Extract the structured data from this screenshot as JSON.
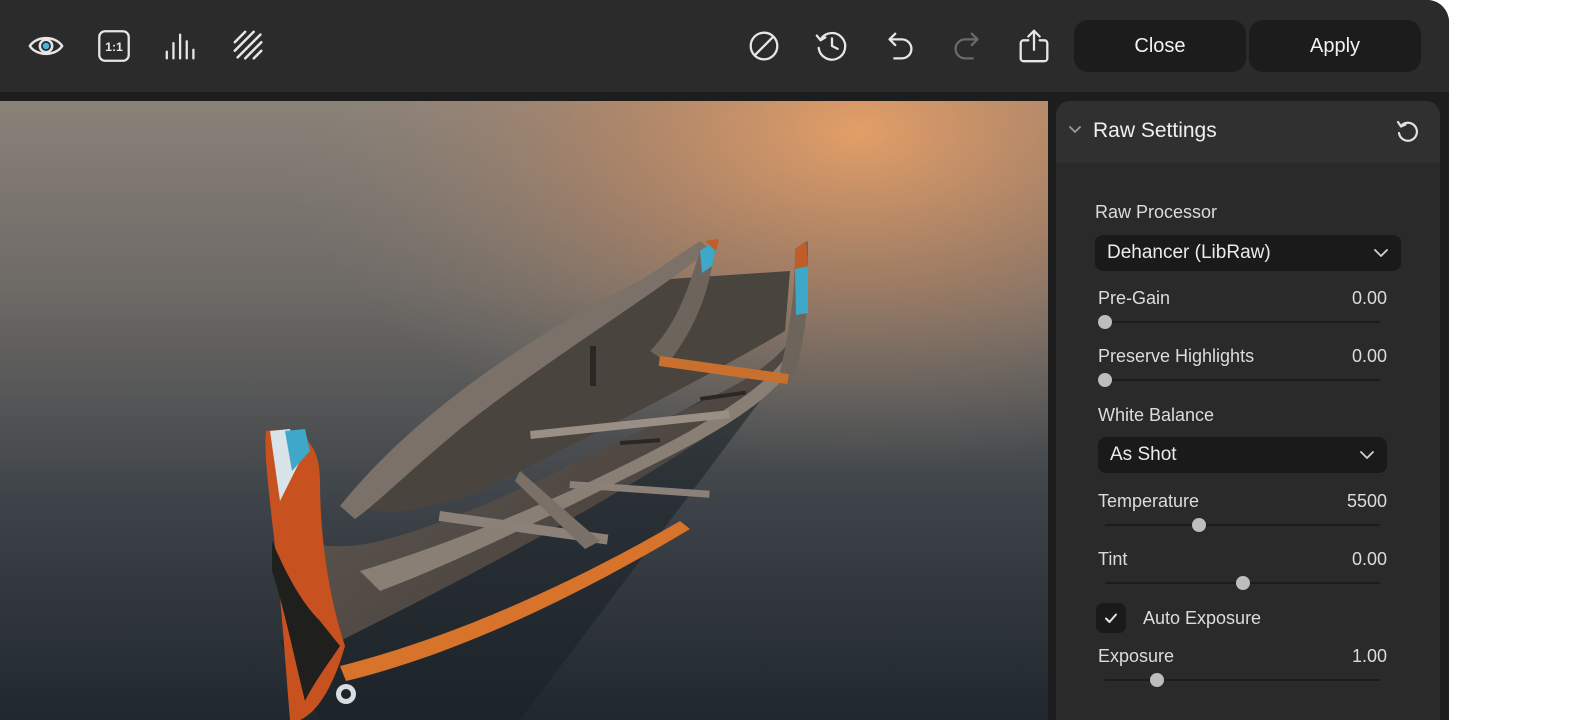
{
  "toolbar": {
    "left_icons": [
      "eye-icon",
      "one-to-one-icon",
      "histogram-icon",
      "hatch-icon"
    ],
    "right_icons": [
      "disable-icon",
      "history-icon",
      "undo-icon",
      "redo-icon",
      "export-icon"
    ],
    "close_label": "Close",
    "apply_label": "Apply"
  },
  "panel": {
    "title": "Raw Settings",
    "raw_processor": {
      "label": "Raw Processor",
      "value": "Dehancer (LibRaw)"
    },
    "pre_gain": {
      "label": "Pre-Gain",
      "value": "0.00",
      "level": 0.0
    },
    "preserve_highlights": {
      "label": "Preserve Highlights",
      "value": "0.00",
      "level": 0.0
    },
    "white_balance": {
      "label": "White Balance",
      "value": "As Shot"
    },
    "temperature": {
      "label": "Temperature",
      "value": "5500",
      "level": 0.34
    },
    "tint": {
      "label": "Tint",
      "value": "0.00",
      "level": 0.5
    },
    "auto_exposure": {
      "label": "Auto Exposure",
      "checked": true
    },
    "exposure": {
      "label": "Exposure",
      "value": "1.00",
      "level": 0.19
    }
  },
  "colors": {
    "accent_eye": "#3fb6e6",
    "toolbar_bg": "#2b2b2b",
    "panel_bg": "#2a2a2a"
  }
}
